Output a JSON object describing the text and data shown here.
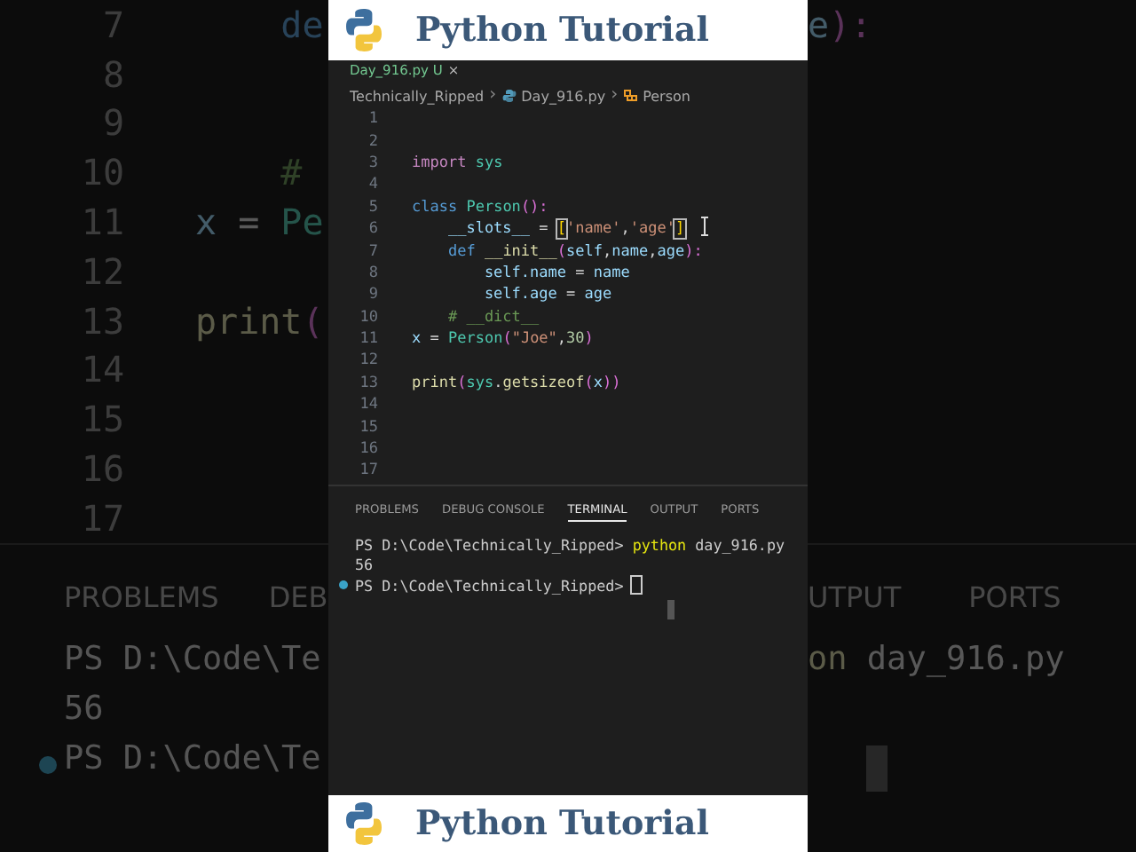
{
  "background": {
    "left": {
      "lines": [
        {
          "number": "7",
          "tokens": [
            {
              "text": "    de",
              "kind": "keyword"
            }
          ]
        },
        {
          "number": "8"
        },
        {
          "number": "9"
        },
        {
          "number": "10",
          "tokens": [
            {
              "text": "    #",
              "kind": "comment"
            }
          ]
        },
        {
          "number": "11",
          "tokens": [
            {
              "text": "x",
              "kind": "var"
            },
            {
              "text": " = ",
              "kind": "plain"
            },
            {
              "text": "Pe",
              "kind": "class"
            }
          ]
        },
        {
          "number": "12"
        },
        {
          "number": "13",
          "tokens": [
            {
              "text": "print",
              "kind": "func"
            },
            {
              "text": "(",
              "kind": "paren"
            }
          ]
        },
        {
          "number": "14"
        },
        {
          "number": "15"
        },
        {
          "number": "16"
        },
        {
          "number": "17"
        }
      ],
      "panel_tabs": [
        "PROBLEMS",
        "DEB"
      ],
      "terminal": [
        {
          "kind": "line",
          "text": "PS D:\\Code\\Te"
        },
        {
          "kind": "line",
          "text": "56"
        },
        {
          "kind": "prompt",
          "text": "PS D:\\Code\\Te"
        }
      ]
    },
    "right": {
      "code": [
        {
          "text": "e",
          "kind": "var"
        },
        {
          "text": "):",
          "kind": "paren"
        }
      ],
      "panel_tabs": [
        "UTPUT",
        "PORTS"
      ],
      "terminal": [
        {
          "text": "on",
          "kind": "func"
        },
        {
          "text": " day_916.py",
          "kind": "plain"
        }
      ]
    }
  },
  "banners": [
    {
      "title": "Python Tutorial"
    },
    {
      "title": "Python Tutorial"
    }
  ],
  "editor": {
    "tab": {
      "label": "Day_916.py",
      "status": "U",
      "close": "×"
    },
    "breadcrumb": [
      {
        "kind": "item",
        "text": "Technically_Ripped"
      },
      {
        "kind": "separator",
        "text": "›"
      },
      {
        "kind": "file",
        "text": "Day_916.py"
      },
      {
        "kind": "separator",
        "text": "›"
      },
      {
        "kind": "class",
        "text": "Person"
      }
    ],
    "lines": [
      {
        "number": "1"
      },
      {
        "number": "2"
      },
      {
        "number": "3",
        "tokens": [
          {
            "text": "import ",
            "kind": "control"
          },
          {
            "text": "sys",
            "kind": "class"
          }
        ]
      },
      {
        "number": "4"
      },
      {
        "number": "5",
        "tokens": [
          {
            "text": "class ",
            "kind": "keyword"
          },
          {
            "text": "Person",
            "kind": "class"
          },
          {
            "text": "():",
            "kind": "paren"
          }
        ]
      },
      {
        "number": "6",
        "tokens": [
          {
            "text": "    __slots__",
            "kind": "var"
          },
          {
            "text": " = ",
            "kind": "plain"
          },
          {
            "text": "[",
            "kind": "bracket"
          },
          {
            "text": "'name'",
            "kind": "string"
          },
          {
            "text": ",",
            "kind": "plain"
          },
          {
            "text": "'age'",
            "kind": "string"
          },
          {
            "text": "]",
            "kind": "bracket"
          }
        ]
      },
      {
        "number": "7",
        "tokens": [
          {
            "text": "    def ",
            "kind": "keyword"
          },
          {
            "text": "__init__",
            "kind": "func"
          },
          {
            "text": "(",
            "kind": "paren"
          },
          {
            "text": "self",
            "kind": "var"
          },
          {
            "text": ",",
            "kind": "plain"
          },
          {
            "text": "name",
            "kind": "var"
          },
          {
            "text": ",",
            "kind": "plain"
          },
          {
            "text": "age",
            "kind": "var"
          },
          {
            "text": "):",
            "kind": "paren"
          }
        ]
      },
      {
        "number": "8",
        "tokens": [
          {
            "text": "        self.name",
            "kind": "var"
          },
          {
            "text": " = ",
            "kind": "plain"
          },
          {
            "text": "name",
            "kind": "var"
          }
        ]
      },
      {
        "number": "9",
        "tokens": [
          {
            "text": "        self.age",
            "kind": "var"
          },
          {
            "text": " = ",
            "kind": "plain"
          },
          {
            "text": "age",
            "kind": "var"
          }
        ]
      },
      {
        "number": "10",
        "tokens": [
          {
            "text": "    # __dict__",
            "kind": "comment"
          }
        ]
      },
      {
        "number": "11",
        "tokens": [
          {
            "text": "x",
            "kind": "var"
          },
          {
            "text": " = ",
            "kind": "plain"
          },
          {
            "text": "Person",
            "kind": "class"
          },
          {
            "text": "(",
            "kind": "paren"
          },
          {
            "text": "\"Joe\"",
            "kind": "string"
          },
          {
            "text": ",",
            "kind": "plain"
          },
          {
            "text": "30",
            "kind": "number"
          },
          {
            "text": ")",
            "kind": "paren"
          }
        ]
      },
      {
        "number": "12"
      },
      {
        "number": "13",
        "tokens": [
          {
            "text": "print",
            "kind": "func"
          },
          {
            "text": "(",
            "kind": "paren"
          },
          {
            "text": "sys",
            "kind": "class"
          },
          {
            "text": ".",
            "kind": "plain"
          },
          {
            "text": "getsizeof",
            "kind": "func"
          },
          {
            "text": "(",
            "kind": "paren"
          },
          {
            "text": "x",
            "kind": "var"
          },
          {
            "text": "))",
            "kind": "paren"
          }
        ]
      },
      {
        "number": "14"
      },
      {
        "number": "15"
      },
      {
        "number": "16"
      },
      {
        "number": "17"
      }
    ]
  },
  "panel": {
    "tabs": [
      {
        "label": "PROBLEMS",
        "selected": false
      },
      {
        "label": "DEBUG CONSOLE",
        "selected": false
      },
      {
        "label": "TERMINAL",
        "selected": true
      },
      {
        "label": "OUTPUT",
        "selected": false
      },
      {
        "label": "PORTS",
        "selected": false
      }
    ],
    "terminal": [
      {
        "kind": "command",
        "prompt": "PS D:\\Code\\Technically_Ripped>",
        "command": "python",
        "args": " day_916.py"
      },
      {
        "kind": "output",
        "text": "56"
      },
      {
        "kind": "prompt",
        "prompt": "PS D:\\Code\\Technically_Ripped>"
      }
    ]
  }
}
